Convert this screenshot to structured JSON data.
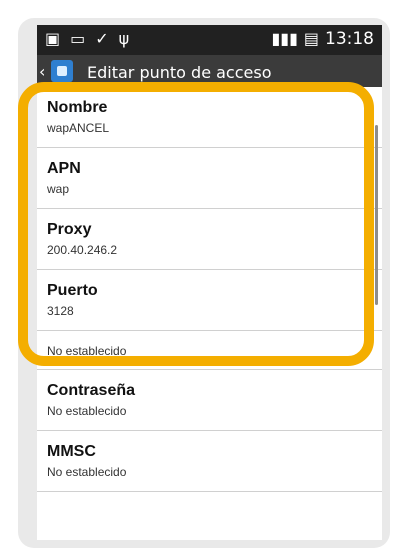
{
  "status_bar": {
    "time": "13:18",
    "icons_left": [
      "sd-card-icon",
      "image-icon",
      "check-icon",
      "usb-icon"
    ],
    "icons_right": [
      "signal-3g-icon",
      "battery-charging-icon"
    ]
  },
  "action_bar": {
    "title": "Editar punto de acceso"
  },
  "list": {
    "items": [
      {
        "label": "Nombre",
        "value": "wapANCEL"
      },
      {
        "label": "APN",
        "value": "wap"
      },
      {
        "label": "Proxy",
        "value": "200.40.246.2"
      },
      {
        "label": "Puerto",
        "value": "3128"
      },
      {
        "label": "",
        "value": "No establecido"
      },
      {
        "label": "Contraseña",
        "value": "No establecido"
      },
      {
        "label": "MMSC",
        "value": "No establecido"
      }
    ]
  },
  "colors": {
    "highlight": "#f4ae00",
    "status_bar": "#212121",
    "action_bar": "#3b3b3b"
  }
}
